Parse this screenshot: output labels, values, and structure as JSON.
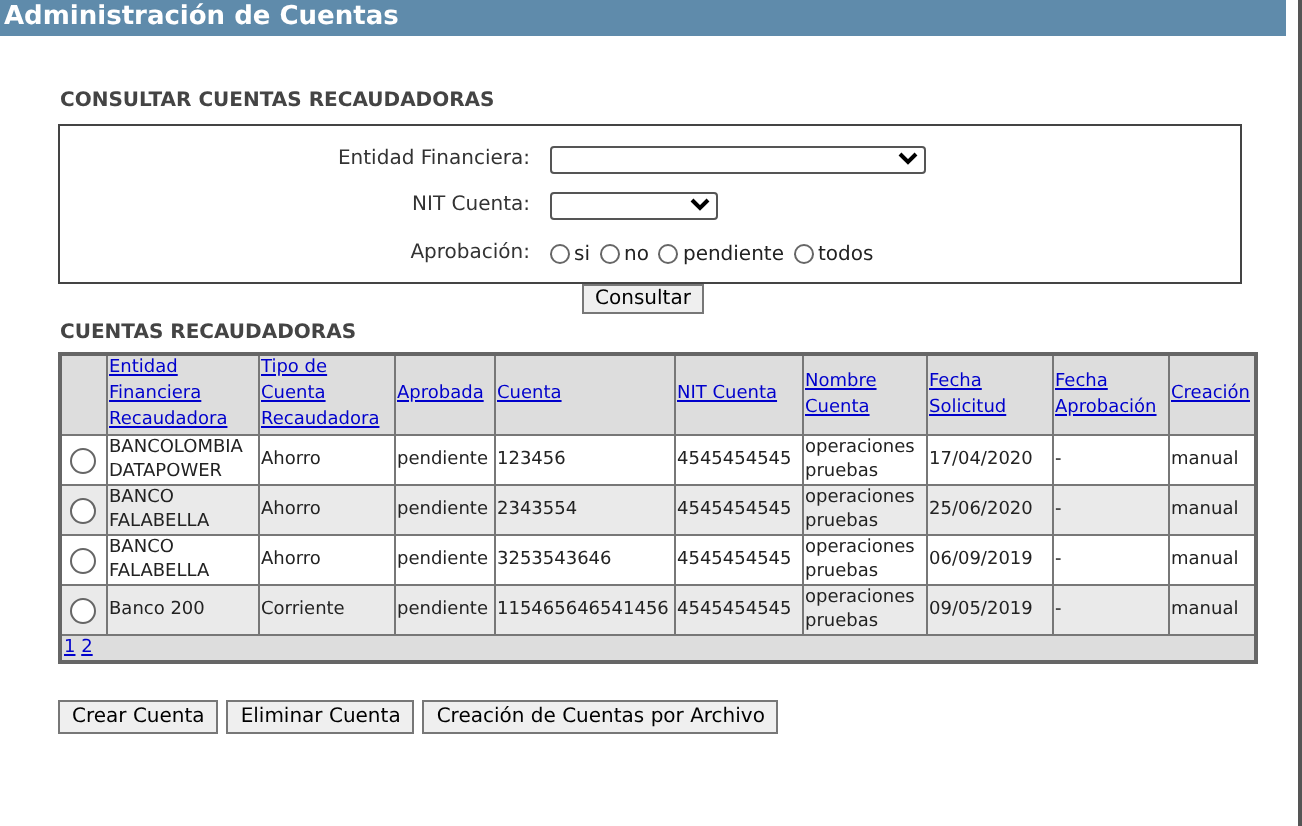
{
  "window": {
    "title": "Administración de Cuentas"
  },
  "query": {
    "heading": "CONSULTAR CUENTAS RECAUDADORAS",
    "fields": [
      {
        "label": "Entidad Financiera:",
        "kind": "select"
      },
      {
        "label": "NIT Cuenta:",
        "kind": "select"
      }
    ],
    "approval": {
      "label": "Aprobación:",
      "options": [
        {
          "label": "si",
          "selected": false
        },
        {
          "label": "no",
          "selected": false
        },
        {
          "label": "pendiente",
          "selected": false
        },
        {
          "label": "todos",
          "selected": false
        }
      ]
    },
    "button": "Consultar"
  },
  "table": {
    "heading": "CUENTAS RECAUDADORAS",
    "columns": [
      "Entidad Financiera Recaudadora",
      "Tipo de Cuenta Recaudadora",
      "Aprobada",
      "Cuenta",
      "NIT Cuenta",
      "Nombre Cuenta",
      "Fecha Solicitud",
      "Fecha Aprobación",
      "Creación"
    ],
    "rows": [
      {
        "selected": false,
        "cells": [
          "BANCOLOMBIA DATAPOWER",
          "Ahorro",
          "pendiente",
          "123456",
          "4545454545",
          "operaciones pruebas",
          "17/04/2020",
          "-",
          "manual"
        ]
      },
      {
        "selected": false,
        "cells": [
          "BANCO FALABELLA",
          "Ahorro",
          "pendiente",
          "2343554",
          "4545454545",
          "operaciones pruebas",
          "25/06/2020",
          "-",
          "manual"
        ]
      },
      {
        "selected": false,
        "cells": [
          "BANCO FALABELLA",
          "Ahorro",
          "pendiente",
          "3253543646",
          "4545454545",
          "operaciones pruebas",
          "06/09/2019",
          "-",
          "manual"
        ]
      },
      {
        "selected": false,
        "cells": [
          "Banco 200",
          "Corriente",
          "pendiente",
          "115465646541456",
          "4545454545",
          "operaciones pruebas",
          "09/05/2019",
          "-",
          "manual"
        ]
      }
    ],
    "pages": [
      "1",
      "2"
    ]
  },
  "buttons": [
    "Crear Cuenta",
    "Eliminar Cuenta",
    "Creación de Cuentas por Archivo"
  ]
}
